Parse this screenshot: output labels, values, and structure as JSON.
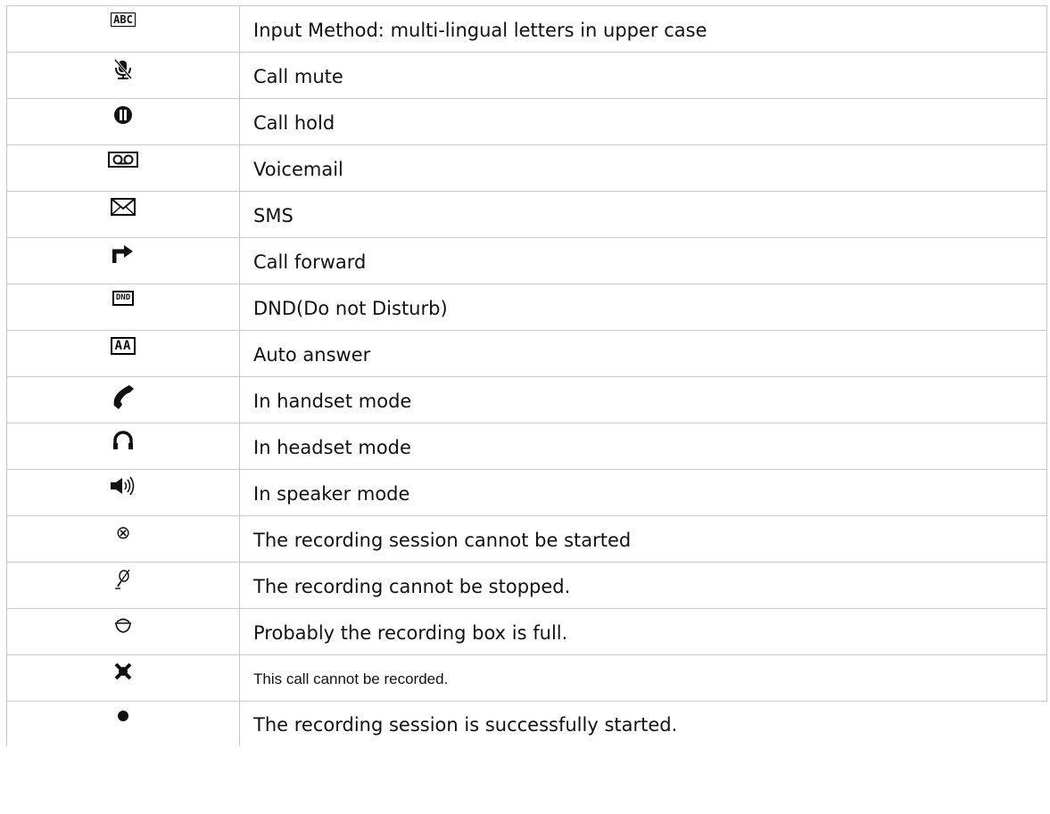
{
  "rows": [
    {
      "icon": "abc-input-icon",
      "glyph": "ABC",
      "text": "Input Method: multi-lingual letters in upper case"
    },
    {
      "icon": "mute-microphone-icon",
      "glyph": "",
      "text": "Call mute"
    },
    {
      "icon": "pause-icon",
      "glyph": "",
      "text": "Call hold"
    },
    {
      "icon": "voicemail-icon",
      "glyph": "",
      "text": "Voicemail"
    },
    {
      "icon": "envelope-icon",
      "glyph": "",
      "text": "SMS"
    },
    {
      "icon": "forward-arrow-icon",
      "glyph": "",
      "text": "Call forward"
    },
    {
      "icon": "dnd-icon",
      "glyph": "DND",
      "text": "DND(Do not Disturb)"
    },
    {
      "icon": "auto-answer-icon",
      "glyph": "AA",
      "text": "Auto answer"
    },
    {
      "icon": "handset-icon",
      "glyph": "",
      "text": "In handset mode"
    },
    {
      "icon": "headset-icon",
      "glyph": "",
      "text": "In headset mode"
    },
    {
      "icon": "speaker-icon",
      "glyph": "",
      "text": "In speaker mode"
    },
    {
      "icon": "cancel-circle-icon",
      "glyph": "⊗",
      "text": "The recording session cannot be started"
    },
    {
      "icon": "mic-crossed-icon",
      "glyph": "",
      "text": "The recording cannot be stopped."
    },
    {
      "icon": "box-full-icon",
      "glyph": "",
      "text": "Probably the recording box is full."
    },
    {
      "icon": "x-mark-icon",
      "glyph": "",
      "text": "This call cannot be recorded."
    },
    {
      "icon": "record-dot-icon",
      "glyph": "",
      "text": "The recording session is successfully started."
    }
  ]
}
